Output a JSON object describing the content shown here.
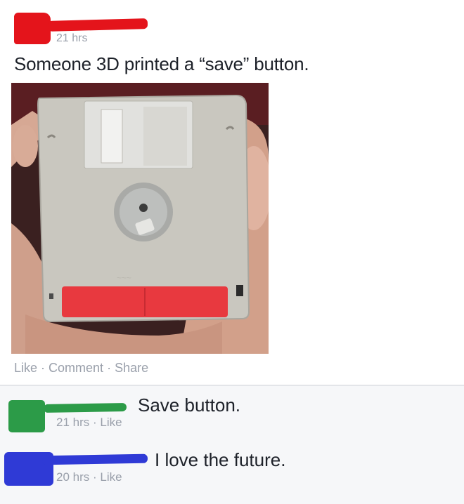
{
  "post": {
    "timestamp": "21 hrs",
    "text": "Someone 3D printed a “save” button.",
    "actions": {
      "like": "Like",
      "sep": " · ",
      "comment": "Comment",
      "share": "Share"
    },
    "photo_subject": "3d-printed-floppy-disk"
  },
  "comments": [
    {
      "text": "Save button.",
      "meta_time": "21 hrs",
      "meta_sep": " · ",
      "meta_like": "Like",
      "avatar_color": "#2c9b48"
    },
    {
      "text": "I love the future.",
      "meta_time": "20 hrs",
      "meta_sep": " · ",
      "meta_like": "Like",
      "avatar_color": "#2f3ad6"
    }
  ],
  "colors": {
    "redaction_post": "#e4141b",
    "meta_text": "#9aa0ab",
    "body_text": "#1d2129",
    "floppy_shutter": "#e8393f"
  }
}
